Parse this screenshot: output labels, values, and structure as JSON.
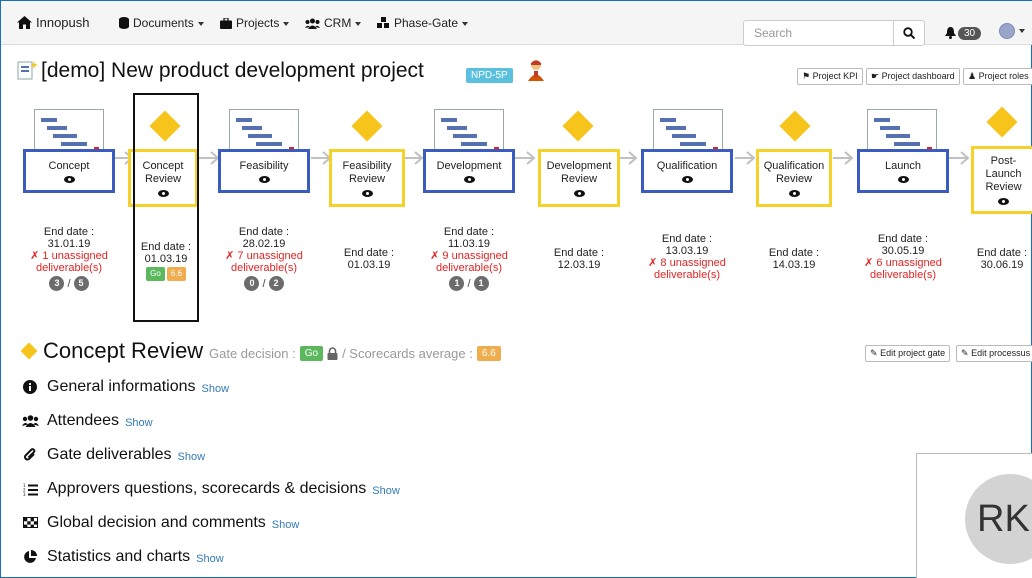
{
  "navbar": {
    "brand": "Innopush",
    "menus": [
      "Documents",
      "Projects",
      "CRM",
      "Phase-Gate"
    ],
    "search_placeholder": "Search",
    "notifications_count": "30"
  },
  "header": {
    "title": "[demo] New product development project",
    "badge": "NPD-5P",
    "buttons": [
      "Project KPI",
      "Project dashboard",
      "Project roles"
    ]
  },
  "process": {
    "end_date_label": "End date :",
    "stages": [
      {
        "label": "Concept",
        "end_date": "31.01.19",
        "unassigned": "✗ 1 unassigned deliverable(s)",
        "done": "3",
        "total": "5"
      },
      {
        "label": "Feasibility",
        "end_date": "28.02.19",
        "unassigned": "✗ 7 unassigned deliverable(s)",
        "done": "0",
        "total": "2"
      },
      {
        "label": "Development",
        "end_date": "11.03.19",
        "unassigned": "✗ 9 unassigned deliverable(s)",
        "done": "1",
        "total": "1"
      },
      {
        "label": "Qualification",
        "end_date": "13.03.19",
        "unassigned": "✗ 8 unassigned deliverable(s)"
      },
      {
        "label": "Launch",
        "end_date": "30.05.19",
        "unassigned": "✗ 6 unassigned deliverable(s)"
      }
    ],
    "gates": [
      {
        "label": "Concept Review",
        "end_date": "01.03.19",
        "decision": "Go",
        "score": "6.6"
      },
      {
        "label": "Feasibility Review",
        "end_date": "01.03.19"
      },
      {
        "label": "Development Review",
        "end_date": "12.03.19"
      },
      {
        "label": "Qualification Review",
        "end_date": "14.03.19"
      },
      {
        "label": "Post-Launch Review",
        "end_date": "30.06.19"
      }
    ]
  },
  "gate_detail": {
    "title": "Concept Review",
    "gate_decision_label": "Gate decision :",
    "decision": "Go",
    "scorecards_label": "/ Scorecards average :",
    "score": "6.6",
    "edit_buttons": [
      "Edit project gate",
      "Edit processus"
    ],
    "show_label": "Show",
    "sections": [
      {
        "label": "General informations",
        "icon": "info-circle-icon"
      },
      {
        "label": "Attendees",
        "icon": "users-icon"
      },
      {
        "label": "Gate deliverables",
        "icon": "paperclip-icon"
      },
      {
        "label": "Approvers questions, scorecards & decisions",
        "icon": "list-icon"
      },
      {
        "label": "Global decision and comments",
        "icon": "checkered-flag-icon"
      },
      {
        "label": "Statistics and charts",
        "icon": "pie-chart-icon"
      }
    ]
  },
  "side_panel": {
    "initials": "RK"
  },
  "colors": {
    "stage_border": "#3a5bbf",
    "gate_border": "#f5d22a",
    "go": "#5cb85c",
    "score": "#f0ad4e",
    "danger": "#e02424",
    "link": "#337ab7"
  }
}
